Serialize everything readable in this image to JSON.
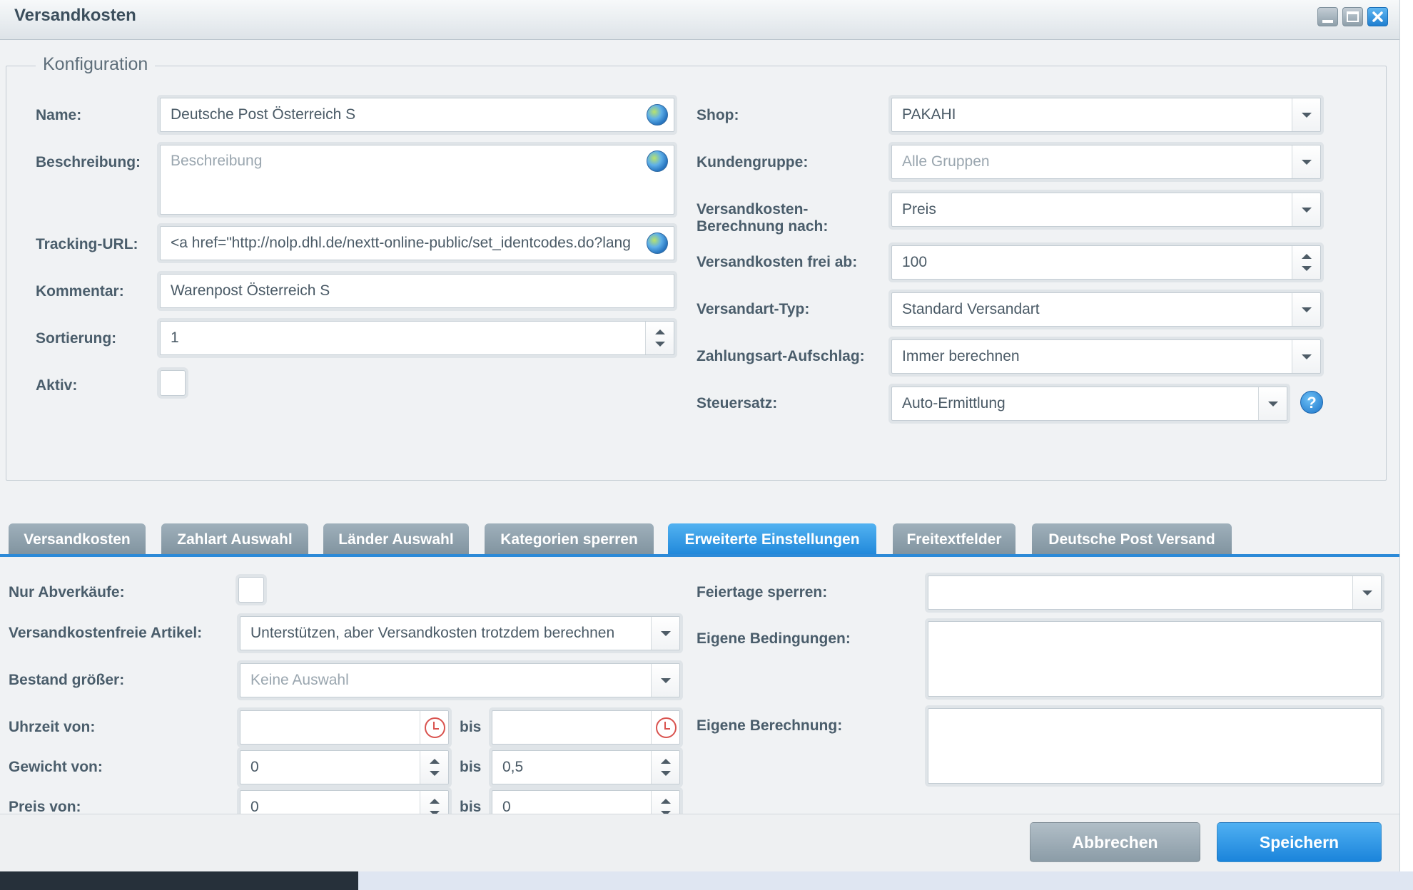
{
  "window": {
    "title": "Versandkosten",
    "controls": [
      "minimize-icon",
      "maximize-icon",
      "close-icon"
    ],
    "accent_color": "#1e86d9"
  },
  "config": {
    "legend": "Konfiguration",
    "left": {
      "name_label": "Name:",
      "name_value": "Deutsche Post Österreich S",
      "beschreibung_label": "Beschreibung:",
      "beschreibung_placeholder": "Beschreibung",
      "tracking_label": "Tracking-URL:",
      "tracking_value": "<a href=\"http://nolp.dhl.de/nextt-online-public/set_identcodes.do?lang",
      "kommentar_label": "Kommentar:",
      "kommentar_value": "Warenpost Österreich S",
      "sortierung_label": "Sortierung:",
      "sortierung_value": "1",
      "aktiv_label": "Aktiv:"
    },
    "right": {
      "shop_label": "Shop:",
      "shop_value": "PAKAHI",
      "kundengruppe_label": "Kundengruppe:",
      "kundengruppe_placeholder": "Alle Gruppen",
      "berechnung_label_1": "Versandkosten-",
      "berechnung_label_2": "Berechnung nach:",
      "berechnung_value": "Preis",
      "frei_label": "Versandkosten frei ab:",
      "frei_value": "100",
      "versandart_label": "Versandart-Typ:",
      "versandart_value": "Standard Versandart",
      "zahlungsart_label": "Zahlungsart-Aufschlag:",
      "zahlungsart_value": "Immer berechnen",
      "steuersatz_label": "Steuersatz:",
      "steuersatz_value": "Auto-Ermittlung",
      "help_symbol": "?"
    }
  },
  "tabs": [
    {
      "label": "Versandkosten",
      "active": false
    },
    {
      "label": "Zahlart Auswahl",
      "active": false
    },
    {
      "label": "Länder Auswahl",
      "active": false
    },
    {
      "label": "Kategorien sperren",
      "active": false
    },
    {
      "label": "Erweiterte Einstellungen",
      "active": true
    },
    {
      "label": "Freitextfelder",
      "active": false
    },
    {
      "label": "Deutsche Post Versand",
      "active": false
    }
  ],
  "advanced": {
    "abverkauf_label": "Nur Abverkäufe:",
    "freie_artikel_label": "Versandkostenfreie Artikel:",
    "freie_artikel_value": "Unterstützen, aber Versandkosten trotzdem berechnen",
    "bestand_label": "Bestand größer:",
    "bestand_placeholder": "Keine Auswahl",
    "uhrzeit_label": "Uhrzeit von:",
    "bis_label": "bis",
    "gewicht_label": "Gewicht von:",
    "gewicht_von": "0",
    "gewicht_bis": "0,5",
    "preis_label": "Preis von:",
    "preis_von": "0",
    "preis_bis": "0",
    "feiertage_label": "Feiertage sperren:",
    "bedingungen_label": "Eigene Bedingungen:",
    "berechnung_label": "Eigene Berechnung:"
  },
  "buttons": {
    "cancel": "Abbrechen",
    "save": "Speichern"
  }
}
